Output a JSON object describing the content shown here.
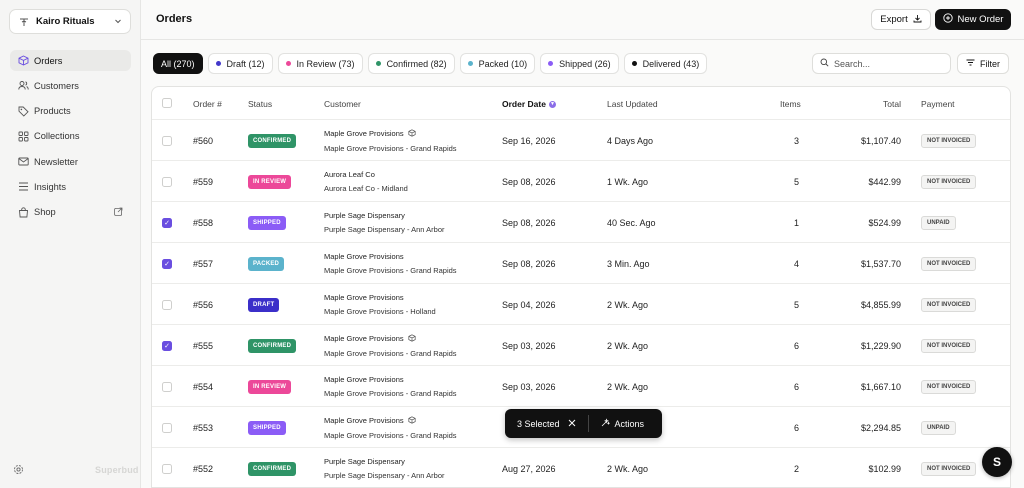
{
  "workspace": {
    "name": "Kairo Rituals"
  },
  "sidebar": {
    "items": [
      {
        "label": "Orders",
        "icon": "box-icon",
        "active": true
      },
      {
        "label": "Customers",
        "icon": "users-icon"
      },
      {
        "label": "Products",
        "icon": "tag-icon"
      },
      {
        "label": "Collections",
        "icon": "grid-icon"
      },
      {
        "label": "Newsletter",
        "icon": "mail-icon"
      },
      {
        "label": "Insights",
        "icon": "list-icon"
      },
      {
        "label": "Shop",
        "icon": "bag-icon",
        "external": true
      }
    ],
    "brand": "Superbud"
  },
  "header": {
    "title": "Orders",
    "export_label": "Export",
    "new_order_label": "New Order"
  },
  "tabs": [
    {
      "label": "All (270)",
      "active": true,
      "dot": ""
    },
    {
      "label": "Draft (12)",
      "dot": "#4338ca"
    },
    {
      "label": "In Review (73)",
      "dot": "#ec4899"
    },
    {
      "label": "Confirmed (82)",
      "dot": "#2f9467"
    },
    {
      "label": "Packed (10)",
      "dot": "#5bb3cc"
    },
    {
      "label": "Shipped (26)",
      "dot": "#8b5cf6"
    },
    {
      "label": "Delivered (43)",
      "dot": "#111111"
    }
  ],
  "search": {
    "placeholder": "Search...",
    "value": ""
  },
  "filter_label": "Filter",
  "table": {
    "columns": [
      "Order #",
      "Status",
      "Customer",
      "Order Date",
      "Last Updated",
      "Items",
      "Total",
      "Payment"
    ],
    "rows": [
      {
        "checked": false,
        "order": "#560",
        "status": "CONFIRMED",
        "status_color": "#2f9467",
        "customer": "Maple Grove Provisions",
        "location": "Maple Grove Provisions - Grand Rapids",
        "pkg": true,
        "date": "Sep 16, 2026",
        "updated": "4 Days Ago",
        "items": "3",
        "total": "$1,107.40",
        "payment": "NOT INVOICED"
      },
      {
        "checked": false,
        "order": "#559",
        "status": "IN REVIEW",
        "status_color": "#ec4899",
        "customer": "Aurora Leaf Co",
        "location": "Aurora Leaf Co - Midland",
        "pkg": false,
        "date": "Sep 08, 2026",
        "updated": "1 Wk. Ago",
        "items": "5",
        "total": "$442.99",
        "payment": "NOT INVOICED"
      },
      {
        "checked": true,
        "order": "#558",
        "status": "SHIPPED",
        "status_color": "#8b5cf6",
        "customer": "Purple Sage Dispensary",
        "location": "Purple Sage Dispensary - Ann Arbor",
        "pkg": false,
        "date": "Sep 08, 2026",
        "updated": "40 Sec. Ago",
        "items": "1",
        "total": "$524.99",
        "payment": "UNPAID"
      },
      {
        "checked": true,
        "order": "#557",
        "status": "PACKED",
        "status_color": "#5bb3cc",
        "customer": "Maple Grove Provisions",
        "location": "Maple Grove Provisions - Grand Rapids",
        "pkg": false,
        "date": "Sep 08, 2026",
        "updated": "3 Min. Ago",
        "items": "4",
        "total": "$1,537.70",
        "payment": "NOT INVOICED"
      },
      {
        "checked": false,
        "order": "#556",
        "status": "DRAFT",
        "status_color": "#3b2fc9",
        "customer": "Maple Grove Provisions",
        "location": "Maple Grove Provisions - Holland",
        "pkg": false,
        "date": "Sep 04, 2026",
        "updated": "2 Wk. Ago",
        "items": "5",
        "total": "$4,855.99",
        "payment": "NOT INVOICED"
      },
      {
        "checked": true,
        "order": "#555",
        "status": "CONFIRMED",
        "status_color": "#2f9467",
        "customer": "Maple Grove Provisions",
        "location": "Maple Grove Provisions - Grand Rapids",
        "pkg": true,
        "date": "Sep 03, 2026",
        "updated": "2 Wk. Ago",
        "items": "6",
        "total": "$1,229.90",
        "payment": "NOT INVOICED"
      },
      {
        "checked": false,
        "order": "#554",
        "status": "IN REVIEW",
        "status_color": "#ec4899",
        "customer": "Maple Grove Provisions",
        "location": "Maple Grove Provisions - Grand Rapids",
        "pkg": false,
        "date": "Sep 03, 2026",
        "updated": "2 Wk. Ago",
        "items": "6",
        "total": "$1,667.10",
        "payment": "NOT INVOICED"
      },
      {
        "checked": false,
        "order": "#553",
        "status": "SHIPPED",
        "status_color": "#8b5cf6",
        "customer": "Maple Grove Provisions",
        "location": "Maple Grove Provisions - Grand Rapids",
        "pkg": true,
        "date": "",
        "updated": "",
        "items": "6",
        "total": "$2,294.85",
        "payment": "UNPAID"
      },
      {
        "checked": false,
        "order": "#552",
        "status": "CONFIRMED",
        "status_color": "#2f9467",
        "customer": "Purple Sage Dispensary",
        "location": "Purple Sage Dispensary - Ann Arbor",
        "pkg": false,
        "date": "Aug 27, 2026",
        "updated": "2 Wk. Ago",
        "items": "2",
        "total": "$102.99",
        "payment": "NOT INVOICED"
      }
    ]
  },
  "selection": {
    "label": "3 Selected",
    "actions_label": "Actions"
  },
  "fab": {
    "label": "S"
  }
}
